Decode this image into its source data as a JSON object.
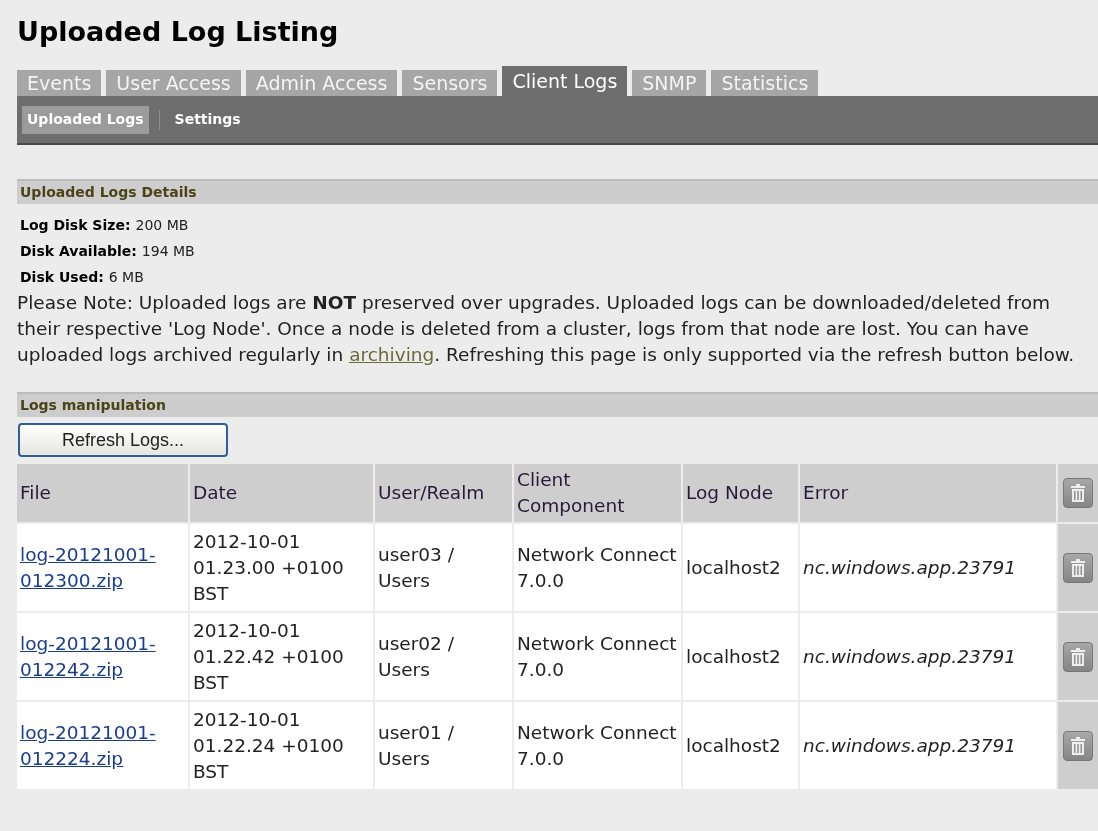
{
  "page_title": "Uploaded Log Listing",
  "tabs": [
    {
      "label": "Events",
      "selected": false
    },
    {
      "label": "User Access",
      "selected": false
    },
    {
      "label": "Admin Access",
      "selected": false
    },
    {
      "label": "Sensors",
      "selected": false
    },
    {
      "label": "Client Logs",
      "selected": true
    },
    {
      "label": "SNMP",
      "selected": false
    },
    {
      "label": "Statistics",
      "selected": false
    }
  ],
  "subtabs": [
    {
      "label": "Uploaded Logs",
      "selected": true
    },
    {
      "label": "Settings",
      "selected": false
    }
  ],
  "details": {
    "title": "Uploaded Logs Details",
    "fields": [
      {
        "label": "Log Disk Size:",
        "value": "200 MB"
      },
      {
        "label": "Disk Available:",
        "value": "194 MB"
      },
      {
        "label": "Disk Used:",
        "value": "6 MB"
      }
    ],
    "note": {
      "before": "Please Note: Uploaded logs are **NOT** preserved over upgrades. Uploaded logs can be downloaded/deleted from their respective 'Log Node'. Once a node is deleted from a cluster, logs from that node are lost. You can have uploaded logs archived regularly in",
      "link": "archiving",
      "after": ". Refreshing this page is only supported via the refresh button below."
    }
  },
  "logs": {
    "title": "Logs manipulation",
    "refresh_button": "Refresh Logs...",
    "table": {
      "columns": [
        "File",
        "Date",
        "User/Realm",
        "Client Component",
        "Log Node",
        "Error"
      ],
      "rows": [
        {
          "file": "log-20121001-012300.zip",
          "date": "2012-10-01 01.23.00 +0100 BST",
          "user": "user03 / Users",
          "component": "Network Connect 7.0.0",
          "node": "localhost2",
          "error": "nc.windows.app.23791"
        },
        {
          "file": "log-20121001-012242.zip",
          "date": "2012-10-01 01.22.42 +0100 BST",
          "user": "user02 / Users",
          "component": "Network Connect 7.0.0",
          "node": "localhost2",
          "error": "nc.windows.app.23791"
        },
        {
          "file": "log-20121001-012224.zip",
          "date": "2012-10-01 01.22.24 +0100 BST",
          "user": "user01 / Users",
          "component": "Network Connect 7.0.0",
          "node": "localhost2",
          "error": "nc.windows.app.23791"
        }
      ]
    }
  }
}
